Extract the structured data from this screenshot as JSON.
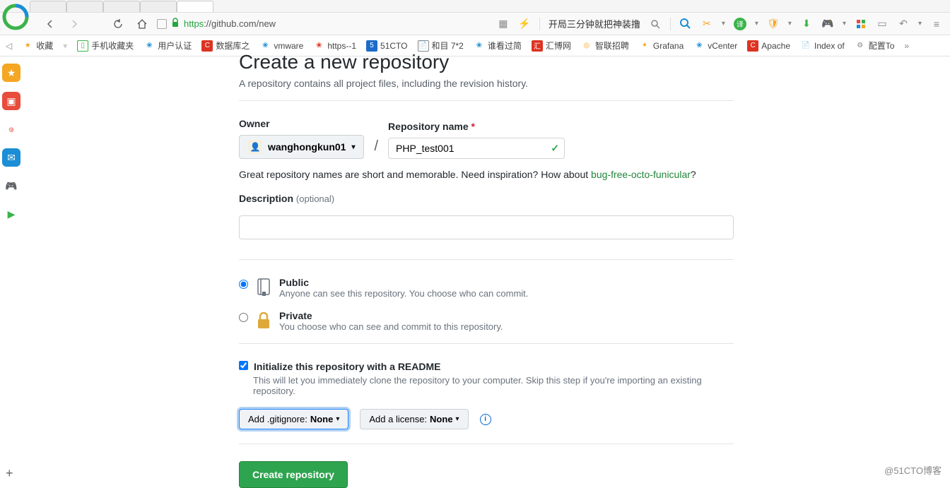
{
  "browser": {
    "url_protocol": "https",
    "url_host_path": "://github.com/new",
    "cn_promo": "开局三分钟就把神装撸"
  },
  "bookmarks": {
    "fav": "收藏",
    "phone": "手机收藏夹",
    "items": [
      "用户认证",
      "数据库之",
      "vmware",
      "https--1",
      "51CTO",
      "和目 7*2",
      "谁看过简",
      "汇博网",
      "智联招聘",
      "Grafana",
      "vCenter",
      "Apache",
      "Index of",
      "配置To"
    ]
  },
  "page": {
    "title": "Create a new repository",
    "subtitle": "A repository contains all project files, including the revision history.",
    "owner_label": "Owner",
    "owner_name": "wanghongkun01",
    "repo_label": "Repository name",
    "repo_value": "PHP_test001",
    "hint_prefix": "Great repository names are short and memorable. Need inspiration? How about ",
    "hint_link": "bug-free-octo-funicular",
    "hint_suffix": "?",
    "desc_label": "Description",
    "desc_optional": "(optional)",
    "desc_value": "",
    "public_title": "Public",
    "public_sub": "Anyone can see this repository. You choose who can commit.",
    "private_title": "Private",
    "private_sub": "You choose who can see and commit to this repository.",
    "readme_title": "Initialize this repository with a README",
    "readme_sub": "This will let you immediately clone the repository to your computer. Skip this step if you're importing an existing repository.",
    "gitignore_label": "Add .gitignore:",
    "gitignore_value": "None",
    "license_label": "Add a license:",
    "license_value": "None",
    "create_btn": "Create repository"
  },
  "watermark": "@51CTO博客"
}
